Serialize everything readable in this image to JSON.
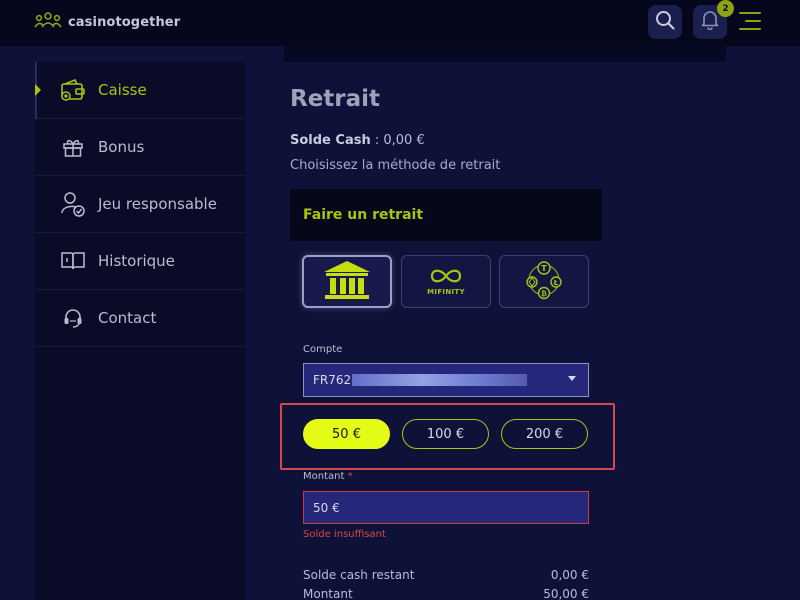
{
  "header": {
    "brand": "casinotogether",
    "notifications_count": "2",
    "icons": [
      "people-logo-icon",
      "search-icon",
      "bell-icon",
      "menu-icon"
    ]
  },
  "sidebar": {
    "items": [
      {
        "label": "Caisse",
        "icon": "wallet-icon",
        "active": true
      },
      {
        "label": "Bonus",
        "icon": "gift-icon"
      },
      {
        "label": "Jeu responsable",
        "icon": "user-check-icon"
      },
      {
        "label": "Historique",
        "icon": "book-icon"
      },
      {
        "label": "Contact",
        "icon": "headset-icon"
      }
    ]
  },
  "main": {
    "title": "Retrait",
    "balance_label": "Solde Cash",
    "balance_value": " : 0,00 €",
    "choose_text": "Choisissez la méthode de retrait",
    "panel_title": "Faire un retrait",
    "methods": [
      {
        "icon": "bank-icon",
        "selected": true
      },
      {
        "label": "MIFINITY",
        "icon": "mifinity-icon"
      },
      {
        "icon": "crypto-icon"
      }
    ],
    "account_label": "Compte",
    "account_value": "FR762",
    "amount_options": [
      "50 €",
      "100 €",
      "200 €"
    ],
    "selected_amount": "50 €",
    "amount_label": "Montant",
    "required_mark": "*",
    "amount_value": "50 €",
    "amount_error": "Solde insuffisant",
    "summary": [
      {
        "label": "Solde cash restant",
        "value": "0,00 €"
      },
      {
        "label": "Montant",
        "value": "50,00 €"
      }
    ]
  },
  "colors": {
    "accent": "#a9c313",
    "accent_bright": "#e4fb16",
    "error": "#d64747",
    "background": "#0f1238"
  }
}
